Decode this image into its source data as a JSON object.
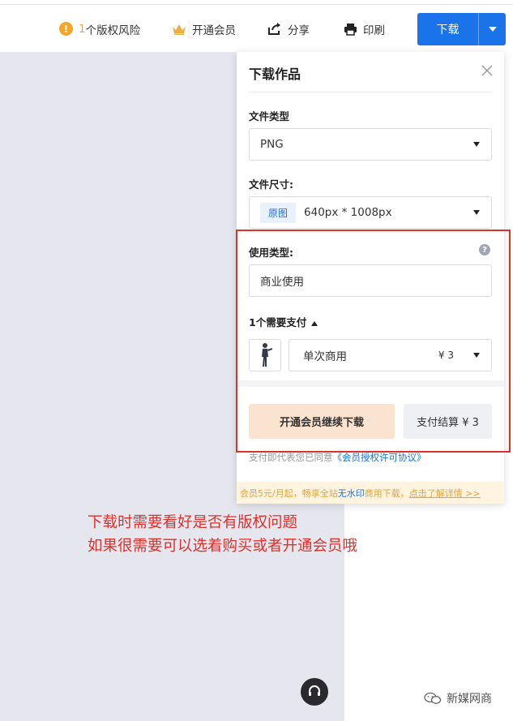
{
  "toolbar": {
    "copyright_risk_count": "1",
    "copyright_risk_label": "个版权风险",
    "member_label": "开通会员",
    "share_label": "分享",
    "print_label": "印刷",
    "download_label": "下载"
  },
  "panel": {
    "title": "下载作品",
    "file_type_label": "文件类型",
    "file_type_value": "PNG",
    "file_size_label": "文件尺寸:",
    "file_size_tag": "原图",
    "file_size_value": "640px * 1008px",
    "usage_type_label": "使用类型:",
    "usage_type_value": "商业使用",
    "pay_count_label": "1个需要支付",
    "license_value": "单次商用",
    "license_price": "¥ 3",
    "member_button": "开通会员继续下载",
    "pay_button": "支付结算 ¥ 3",
    "agree_text": "支付即代表您已同意",
    "agree_link": "《会员授权许可协议》",
    "promo_text_1": "会员5元/月起，畅享全站",
    "promo_text_2": "无水印",
    "promo_text_3": "商用下载，",
    "promo_link": "点击了解详情 >>"
  },
  "annotation": {
    "line1": "下载时需要看好是否有版权问题",
    "line2": "如果很需要可以选着购买或者开通会员哦"
  },
  "watermark": {
    "text": "新媒网商"
  },
  "colors": {
    "accent": "#1a73e8",
    "warning": "#f5a623",
    "annotation_red": "#e0302a"
  }
}
